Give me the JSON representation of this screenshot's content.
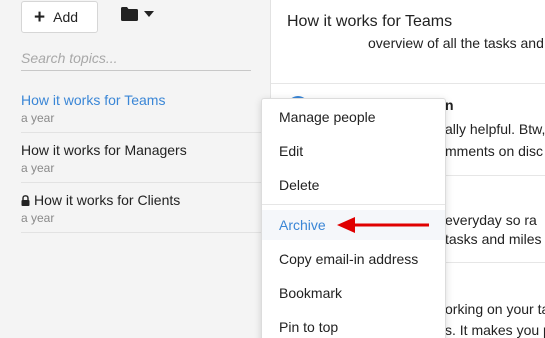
{
  "sidebar": {
    "add_label": "Add",
    "search_placeholder": "Search topics...",
    "topics": [
      {
        "title": "How it works for Teams",
        "sub": "a year",
        "active": true
      },
      {
        "title": "How it works for Managers",
        "sub": "a year"
      },
      {
        "title": "How it works for Clients",
        "sub": "a year",
        "locked": true
      }
    ]
  },
  "main": {
    "title": "How it works for Teams",
    "fragments": [
      "overview of all the tasks and",
      "n",
      "ally helpful. Btw,",
      "mments on disc",
      "everyday so ra",
      "tasks and miles",
      "orking on your ta",
      "s. It makes you p"
    ]
  },
  "menu": {
    "items": [
      {
        "label": "Manage people"
      },
      {
        "label": "Edit"
      },
      {
        "label": "Delete"
      },
      {
        "label": "Archive",
        "highlighted": true
      },
      {
        "label": "Copy email-in address"
      },
      {
        "label": "Bookmark"
      },
      {
        "label": "Pin to top"
      }
    ]
  },
  "icons": {
    "add": "plus-icon",
    "folder": "folder-icon",
    "caret": "caret-down-icon",
    "lock": "lock-icon",
    "arrow": "red-arrow-annotation"
  },
  "colors": {
    "accent": "#3a86d6",
    "annotation": "#e00000",
    "sidebar_bg": "#f4f4f4"
  }
}
